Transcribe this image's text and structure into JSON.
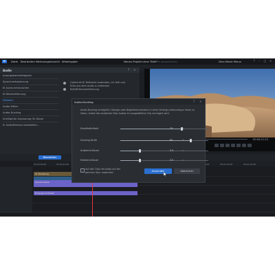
{
  "menubar": {
    "logo": "D",
    "items": [
      "Datei",
      "Bearbeiten",
      "Werkzeuge",
      "Ansicht",
      "Wiedergabe"
    ],
    "document_title": "Neues Projekt ohne Titel*",
    "document_sub": "(nicht gespeichert)",
    "user": "Dina Marie Minus",
    "window_buttons": [
      "?",
      "–",
      "□",
      "×"
    ]
  },
  "audio_panel": {
    "title": "Audio",
    "items": [
      "Auszugskammetappeln",
      "Sprachverbesserung",
      "KI Audio entrauschen",
      "KI Windentfernung",
      "Dellwert",
      "Audio-Editor",
      "Audio-Ducking",
      "Intelligente Anpassung für Dauer",
      "In AudioDirector bearbeiten..."
    ],
    "active_index": 4,
    "right_text_1": "CyberLink KI Tellenerkl anwenden, um Hall und",
    "right_text_2": "Echo aus dem Audio zu entfernen",
    "right_text_3": "KI/KI/KI-Raumentfernung"
  },
  "preview": {
    "timecode": "00:00:11:15"
  },
  "timeline": {
    "track_button": "Bearbeiten",
    "ruler": [
      "00:00:00:00",
      "00:00:10:00",
      "00:00:20:00",
      "00:00:30:00",
      "00:00:40:00",
      "00:00:50:00",
      "00:01:00:00",
      "00:01:10:00",
      "00:01:20:00",
      "00:01:30:00"
    ],
    "clips": {
      "video": "01 Einleitung",
      "audio_main": "Sprache-Rede",
      "audio_lower": "Hintergrund-Musik"
    }
  },
  "dialog": {
    "title": "Audio-Ducking",
    "help": "?",
    "close": "×",
    "description_1": "Audio-Ducking ermöglicht, Dialoge oder Begleitkommentare in einer Hintergrundmusikspur leiser zu",
    "description_2": "hören, indem die ausblende Dies Audios im ausgewählten Clip verringert wird.",
    "sliders": [
      {
        "label": "Empfindlichkeit",
        "value": "70",
        "unit": "%",
        "fraction": 0.7
      },
      {
        "label": "Ducking-Stufe",
        "value": "80",
        "unit": "%",
        "fraction": 0.8
      },
      {
        "label": "Ausblend-Dauer",
        "value": "0.5",
        "unit": "s",
        "fraction": 0.22
      },
      {
        "label": "Einblend-Dauer",
        "value": "0.5",
        "unit": "s",
        "fraction": 0.22
      }
    ],
    "checkbox_label_1": "Auf alle Clips mit Audio auf der",
    "checkbox_label_2": "gleichen Spur anwenden",
    "apply_label": "Anwenden",
    "cancel_label": "Abbrechen"
  },
  "colors": {
    "accent": "#2a6fd0",
    "audio_clip": "#6c63c9",
    "video_clip": "#6a5a3a"
  }
}
